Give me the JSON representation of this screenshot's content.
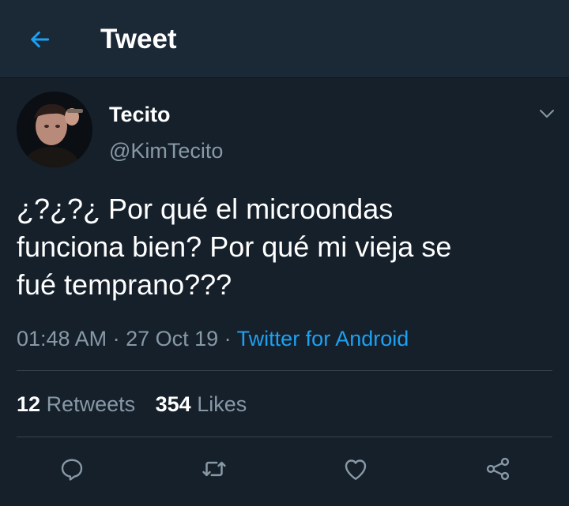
{
  "header": {
    "title": "Tweet",
    "back_icon": "arrow-left-icon",
    "accent": "#1da1f2"
  },
  "tweet": {
    "display_name": "Tecito",
    "handle": "@KimTecito",
    "text_lines": [
      "¿?¿?¿ Por qué el microondas",
      "funciona bien? Por qué mi vieja se",
      "fué temprano???"
    ],
    "time": "01:48 AM",
    "separator": " · ",
    "date": "27 Oct 19",
    "source": "Twitter for Android"
  },
  "stats": {
    "retweets_count": "12",
    "retweets_label": "Retweets",
    "likes_count": "354",
    "likes_label": "Likes"
  },
  "actions": {
    "reply_icon": "reply-icon",
    "retweet_icon": "retweet-icon",
    "like_icon": "heart-icon",
    "share_icon": "share-icon"
  },
  "colors": {
    "background": "#15202b",
    "header_background": "#1b2836",
    "secondary_text": "#8899a6",
    "divider": "#38444d"
  }
}
